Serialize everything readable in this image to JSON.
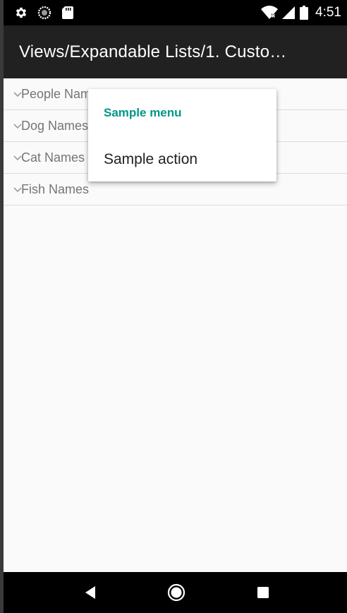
{
  "status_bar": {
    "time": "4:51",
    "left_icons": [
      "settings-icon",
      "sync-icon",
      "sd-card-icon"
    ],
    "right_icons": [
      "wifi-icon",
      "signal-icon",
      "battery-icon"
    ]
  },
  "app_bar": {
    "title": "Views/Expandable Lists/1. Custo…"
  },
  "list": {
    "groups": [
      {
        "label": "People Names"
      },
      {
        "label": "Dog Names"
      },
      {
        "label": "Cat Names"
      },
      {
        "label": "Fish Names"
      }
    ]
  },
  "context_menu": {
    "title": "Sample menu",
    "items": [
      {
        "label": "Sample action"
      }
    ]
  },
  "nav_bar": {
    "buttons": [
      "back-icon",
      "home-icon",
      "recents-icon"
    ]
  },
  "colors": {
    "accent": "#009688",
    "app_bar": "#212121",
    "status_bar": "#000000",
    "background": "#fafafa"
  }
}
